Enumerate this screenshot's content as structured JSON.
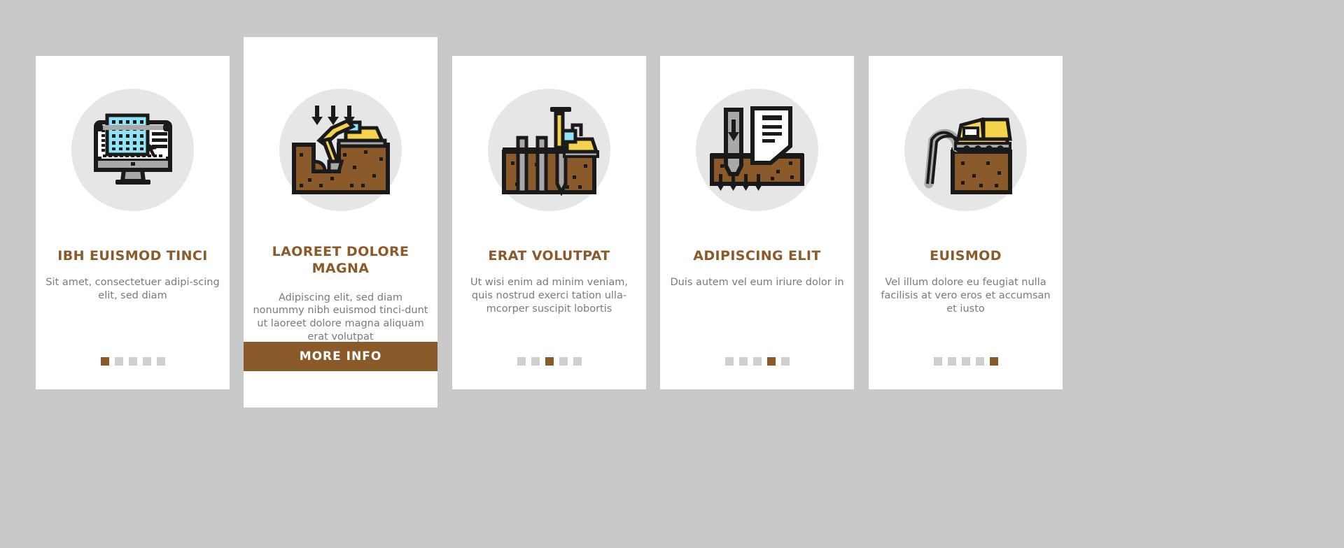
{
  "page": {
    "background_color": "#c9c9c9",
    "card_background": "#ffffff",
    "accent_color": "#8b5a2b",
    "title_color": "#8b5a2b",
    "body_text_color": "#7a7a7a",
    "dot_inactive_color": "#cfcfcf",
    "icon_circle_color": "#e6e6e6"
  },
  "cards": [
    {
      "icon_name": "cad-monitor-icon",
      "title": "IBH EUISMOD TINCI",
      "description": "Sit amet, consectetuer adipi-scing elit, sed diam",
      "dots": {
        "count": 5,
        "active_index": 0
      },
      "featured": false
    },
    {
      "icon_name": "excavator-digging-icon",
      "title": "LAOREET DOLORE MAGNA",
      "description": "Adipiscing elit, sed diam nonummy nibh euismod tinci-dunt ut laoreet dolore magna aliquam erat volutpat",
      "button_label": "MORE INFO",
      "featured": true
    },
    {
      "icon_name": "pile-driver-icon",
      "title": "ERAT VOLUTPAT",
      "description": "Ut wisi enim ad minim veniam, quis nostrud exerci tation ulla-mcorper suscipit lobortis",
      "dots": {
        "count": 5,
        "active_index": 2
      },
      "featured": false
    },
    {
      "icon_name": "foundation-pile-document-icon",
      "title": "ADIPISCING ELIT",
      "description": "Duis autem vel eum iriure dolor in",
      "dots": {
        "count": 5,
        "active_index": 3
      },
      "featured": false
    },
    {
      "icon_name": "concrete-pump-truck-icon",
      "title": "EUISMOD",
      "description": "Vel illum dolore eu feugiat nulla facilisis at vero eros et accumsan et iusto",
      "dots": {
        "count": 5,
        "active_index": 4
      },
      "featured": false
    }
  ]
}
